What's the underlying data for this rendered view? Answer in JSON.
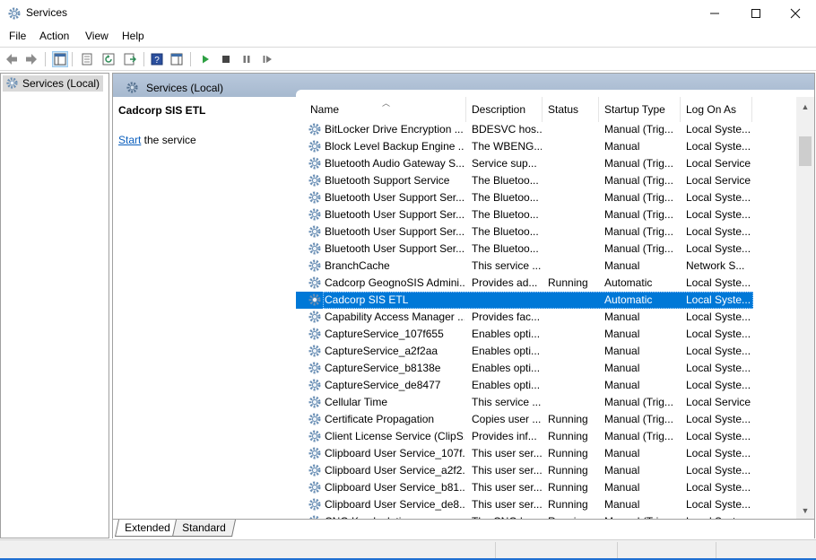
{
  "window": {
    "title": "Services"
  },
  "menu": [
    "File",
    "Action",
    "View",
    "Help"
  ],
  "tree": {
    "root_label": "Services (Local)"
  },
  "pane": {
    "header_title": "Services (Local)",
    "selected_service_title": "Cadcorp SIS ETL",
    "start_link": "Start",
    "start_suffix": " the service"
  },
  "columns": {
    "name": "Name",
    "description": "Description",
    "status": "Status",
    "startup_type": "Startup Type",
    "log_on_as": "Log On As"
  },
  "rows": [
    {
      "name": "BitLocker Drive Encryption ...",
      "description": "BDESVC hos...",
      "status": "",
      "startup": "Manual (Trig...",
      "logon": "Local Syste..."
    },
    {
      "name": "Block Level Backup Engine ...",
      "description": "The WBENG...",
      "status": "",
      "startup": "Manual",
      "logon": "Local Syste..."
    },
    {
      "name": "Bluetooth Audio Gateway S...",
      "description": "Service sup...",
      "status": "",
      "startup": "Manual (Trig...",
      "logon": "Local Service"
    },
    {
      "name": "Bluetooth Support Service",
      "description": "The Bluetoo...",
      "status": "",
      "startup": "Manual (Trig...",
      "logon": "Local Service"
    },
    {
      "name": "Bluetooth User Support Ser...",
      "description": "The Bluetoo...",
      "status": "",
      "startup": "Manual (Trig...",
      "logon": "Local Syste..."
    },
    {
      "name": "Bluetooth User Support Ser...",
      "description": "The Bluetoo...",
      "status": "",
      "startup": "Manual (Trig...",
      "logon": "Local Syste..."
    },
    {
      "name": "Bluetooth User Support Ser...",
      "description": "The Bluetoo...",
      "status": "",
      "startup": "Manual (Trig...",
      "logon": "Local Syste..."
    },
    {
      "name": "Bluetooth User Support Ser...",
      "description": "The Bluetoo...",
      "status": "",
      "startup": "Manual (Trig...",
      "logon": "Local Syste..."
    },
    {
      "name": "BranchCache",
      "description": "This service ...",
      "status": "",
      "startup": "Manual",
      "logon": "Network S..."
    },
    {
      "name": "Cadcorp GeognoSIS Admini...",
      "description": "Provides ad...",
      "status": "Running",
      "startup": "Automatic",
      "logon": "Local Syste..."
    },
    {
      "name": "Cadcorp SIS ETL",
      "description": "",
      "status": "",
      "startup": "Automatic",
      "logon": "Local Syste...",
      "selected": true
    },
    {
      "name": "Capability Access Manager ...",
      "description": "Provides fac...",
      "status": "",
      "startup": "Manual",
      "logon": "Local Syste..."
    },
    {
      "name": "CaptureService_107f655",
      "description": "Enables opti...",
      "status": "",
      "startup": "Manual",
      "logon": "Local Syste..."
    },
    {
      "name": "CaptureService_a2f2aa",
      "description": "Enables opti...",
      "status": "",
      "startup": "Manual",
      "logon": "Local Syste..."
    },
    {
      "name": "CaptureService_b8138e",
      "description": "Enables opti...",
      "status": "",
      "startup": "Manual",
      "logon": "Local Syste..."
    },
    {
      "name": "CaptureService_de8477",
      "description": "Enables opti...",
      "status": "",
      "startup": "Manual",
      "logon": "Local Syste..."
    },
    {
      "name": "Cellular Time",
      "description": "This service ...",
      "status": "",
      "startup": "Manual (Trig...",
      "logon": "Local Service"
    },
    {
      "name": "Certificate Propagation",
      "description": "Copies user ...",
      "status": "Running",
      "startup": "Manual (Trig...",
      "logon": "Local Syste..."
    },
    {
      "name": "Client License Service (ClipS...",
      "description": "Provides inf...",
      "status": "Running",
      "startup": "Manual (Trig...",
      "logon": "Local Syste..."
    },
    {
      "name": "Clipboard User Service_107f...",
      "description": "This user ser...",
      "status": "Running",
      "startup": "Manual",
      "logon": "Local Syste..."
    },
    {
      "name": "Clipboard User Service_a2f2...",
      "description": "This user ser...",
      "status": "Running",
      "startup": "Manual",
      "logon": "Local Syste..."
    },
    {
      "name": "Clipboard User Service_b81...",
      "description": "This user ser...",
      "status": "Running",
      "startup": "Manual",
      "logon": "Local Syste..."
    },
    {
      "name": "Clipboard User Service_de8...",
      "description": "This user ser...",
      "status": "Running",
      "startup": "Manual",
      "logon": "Local Syste..."
    },
    {
      "name": "CNG Key Isolation",
      "description": "The CNG ke...",
      "status": "Running",
      "startup": "Manual (Trig...",
      "logon": "Local Syste..."
    }
  ],
  "tabs": [
    "Extended",
    "Standard"
  ],
  "icons": {
    "service": "gear-icon",
    "back": "back-arrow-icon",
    "forward": "forward-arrow-icon",
    "play": "play-icon",
    "stop": "stop-icon",
    "pause": "pause-icon",
    "restart": "restart-icon"
  },
  "colors": {
    "selection": "#0078d7",
    "header_band": "#a7b9cf",
    "link": "#0b5fbd",
    "play": "#2ea043"
  }
}
